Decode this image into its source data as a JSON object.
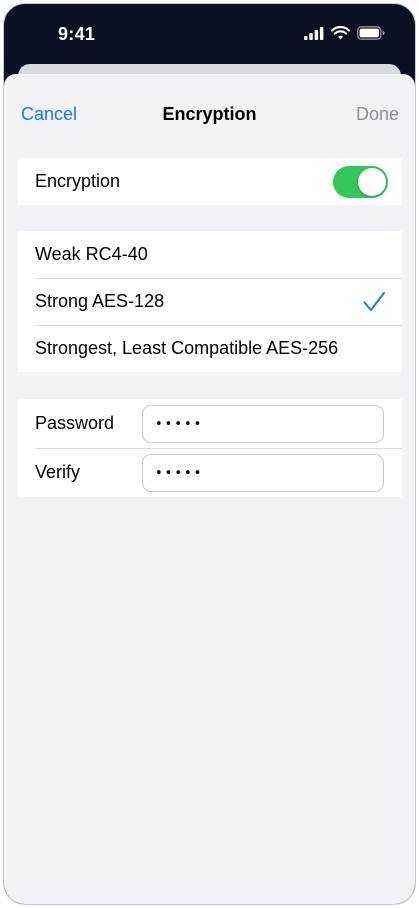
{
  "status_bar": {
    "time": "9:41",
    "icons": [
      "cellular-signal-icon",
      "wifi-icon",
      "battery-icon"
    ]
  },
  "nav": {
    "cancel_label": "Cancel",
    "title": "Encryption",
    "done_label": "Done"
  },
  "encryption_toggle": {
    "label": "Encryption",
    "enabled": true
  },
  "options": [
    {
      "label": "Weak RC4-40",
      "selected": false
    },
    {
      "label": "Strong AES-128",
      "selected": true
    },
    {
      "label": "Strongest, Least Compatible AES-256",
      "selected": false
    }
  ],
  "fields": {
    "password": {
      "label": "Password",
      "value": "•••••"
    },
    "verify": {
      "label": "Verify",
      "value": "•••••"
    }
  },
  "colors": {
    "accent": "#0a7cff",
    "toggle_on": "#34c759",
    "disabled_text": "#8e8e93",
    "background": "#f2f2f7"
  }
}
